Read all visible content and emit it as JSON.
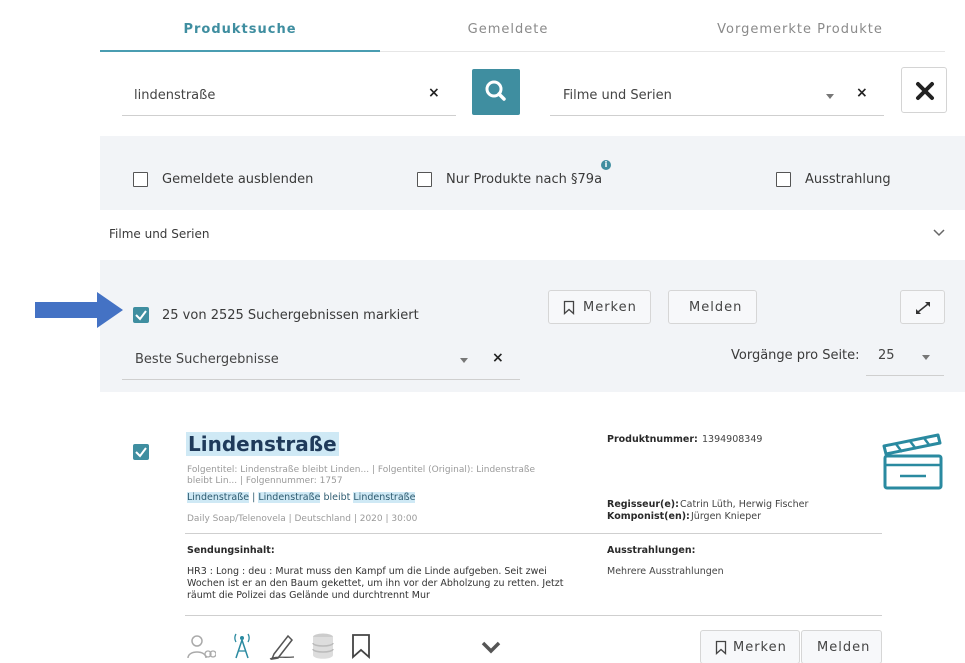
{
  "tabs": [
    {
      "label": "Produktsuche",
      "active": true
    },
    {
      "label": "Gemeldete",
      "active": false
    },
    {
      "label": "Vorgemerkte Produkte",
      "active": false
    }
  ],
  "search": {
    "value": "lindenstraße",
    "clear_glyph": "×",
    "category_value": "Filme und Serien"
  },
  "filters": {
    "hide_reported_label": "Gemeldete ausblenden",
    "only_79a_label": "Nur Produkte nach §79a",
    "info_glyph": "i",
    "broadcast_label": "Ausstrahlung"
  },
  "accordion": {
    "label": "Filme und Serien"
  },
  "results": {
    "selected_text": "25 von 2525 Suchergebnissen markiert",
    "merken_label": "Merken",
    "melden_label": "Melden",
    "sort_value": "Beste Suchergebnisse",
    "per_page_label": "Vorgänge pro Seite:",
    "per_page_value": "25"
  },
  "card": {
    "title": "Lindenstraße",
    "meta_line_1": "Folgentitel: Lindenstraße bleibt Linden... | Folgentitel (Original): Lindenstraße",
    "meta_line_2": "bleibt Lin... | Folgennummer: 1757",
    "highlight_parts": [
      "Lindenstraße",
      " | ",
      "Lindenstraße",
      " bleibt ",
      "Lindenstraße"
    ],
    "genre_line": "Daily Soap/Telenovela | Deutschland | 2020 | 30:00",
    "product_number_label": "Produktnummer:",
    "product_number": "1394908349",
    "director_label": "Regisseur(e):",
    "director": "Catrin Lüth, Herwig Fischer",
    "composer_label": "Komponist(en):",
    "composer": "Jürgen Knieper",
    "content_label": "Sendungsinhalt:",
    "content_text": "HR3 : Long : deu : Murat muss den Kampf um die Linde aufgeben. Seit zwei Wochen ist er an den Baum gekettet, um ihn vor der Abholzung zu retten. Jetzt räumt die Polizei das Gelände und durchtrennt Mur",
    "broadcasts_label": "Ausstrahlungen:",
    "broadcasts_value": "Mehrere Ausstrahlungen",
    "merken_label": "Merken",
    "melden_label": "Melden"
  },
  "colors": {
    "accent": "#3f8ea0",
    "panel": "#f2f4f7",
    "highlight": "#cfe9f5",
    "arrow": "#4472c4"
  }
}
